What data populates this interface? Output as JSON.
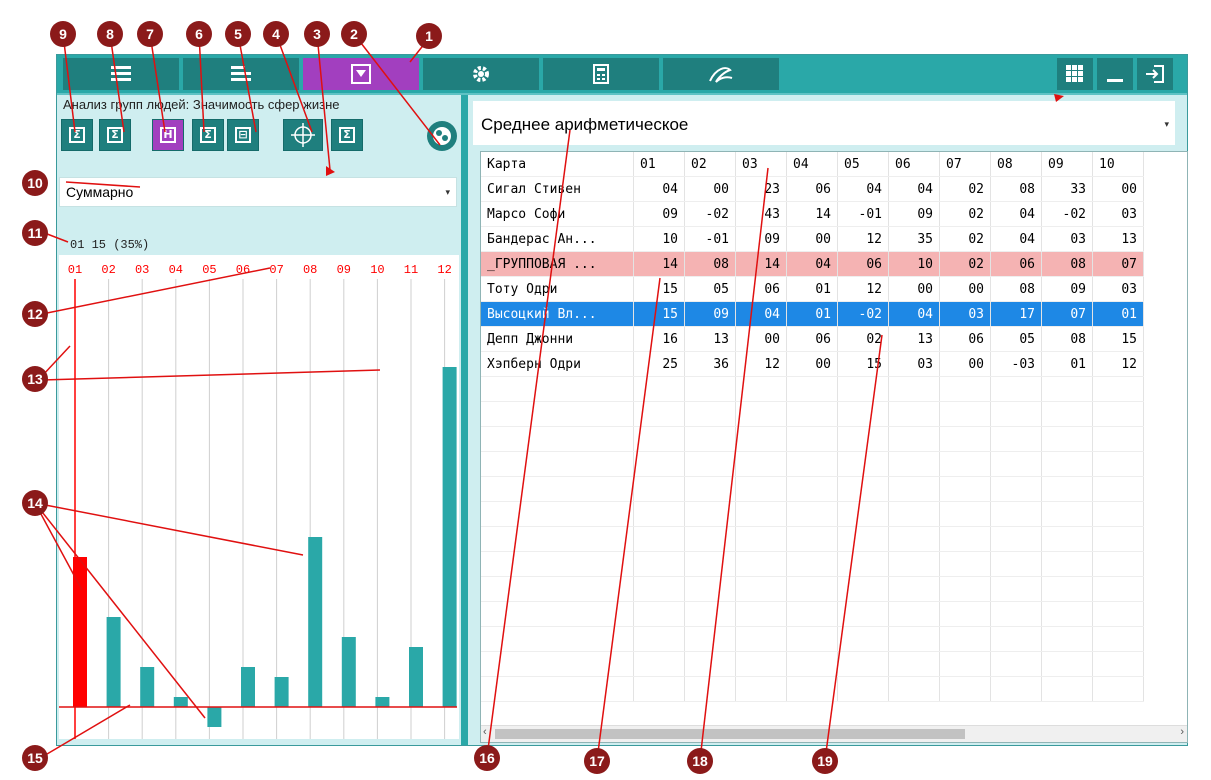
{
  "app": {
    "accent": "#2aa8a8",
    "dark_teal": "#1f7f7e",
    "active_purple": "#a23fbf",
    "tabs": [
      {
        "icon": "list-icon"
      },
      {
        "icon": "list-alt-icon"
      },
      {
        "icon": "filter-icon"
      },
      {
        "icon": "gear-icon"
      },
      {
        "icon": "calculator-icon"
      },
      {
        "icon": "signature-icon"
      }
    ],
    "window_buttons": [
      {
        "icon": "grid-icon"
      },
      {
        "icon": "minimize-icon"
      },
      {
        "icon": "exit-icon"
      }
    ]
  },
  "left": {
    "title": "Анализ групп людей: Значимость сфер жизне",
    "toolbar": [
      {
        "glyph": "Σ",
        "icon": "sum-icon"
      },
      {
        "glyph": "Σ",
        "icon": "sum-weighted-icon"
      },
      {
        "glyph": "H",
        "icon": "histogram-icon"
      },
      {
        "glyph": "Σ",
        "icon": "sum-alt-icon"
      },
      {
        "glyph": "⊟",
        "icon": "collapse-icon"
      },
      {
        "glyph": "⊕",
        "icon": "crosshair-icon"
      },
      {
        "glyph": "Σ",
        "icon": "sum-total-icon"
      }
    ],
    "extra_button_icon": "palette-icon",
    "mode_select": "Суммарно",
    "status": "01 15 (35%)",
    "chart_data": {
      "type": "bar",
      "categories": [
        "01",
        "02",
        "03",
        "04",
        "05",
        "06",
        "07",
        "08",
        "09",
        "10",
        "11",
        "12"
      ],
      "values": [
        15,
        9,
        4,
        1,
        -2,
        4,
        3,
        17,
        7,
        1,
        6,
        34
      ],
      "highlight_index": 0,
      "colors": {
        "bar": "#2aa8a8",
        "highlight": "#ff0000",
        "labels": "#ff0000"
      }
    }
  },
  "right": {
    "aggregate_select": "Среднее арифметическое",
    "table": {
      "columns": [
        "Карта",
        "01",
        "02",
        "03",
        "04",
        "05",
        "06",
        "07",
        "08",
        "09",
        "10"
      ],
      "rows": [
        {
          "name": "Сигал Стивен",
          "values": [
            "04",
            "00",
            "23",
            "06",
            "04",
            "04",
            "02",
            "08",
            "33",
            "00"
          ],
          "state": ""
        },
        {
          "name": "Марсо Софи",
          "values": [
            "09",
            "-02",
            "43",
            "14",
            "-01",
            "09",
            "02",
            "04",
            "-02",
            "03"
          ],
          "state": ""
        },
        {
          "name": "Бандерас Ан...",
          "values": [
            "10",
            "-01",
            "09",
            "00",
            "12",
            "35",
            "02",
            "04",
            "03",
            "13"
          ],
          "state": ""
        },
        {
          "name": "_ГРУППОВАЯ ...",
          "values": [
            "14",
            "08",
            "14",
            "04",
            "06",
            "10",
            "02",
            "06",
            "08",
            "07"
          ],
          "state": "group"
        },
        {
          "name": "Тоту Одри",
          "values": [
            "15",
            "05",
            "06",
            "01",
            "12",
            "00",
            "00",
            "08",
            "09",
            "03"
          ],
          "state": ""
        },
        {
          "name": "Высоцкий Вл...",
          "values": [
            "15",
            "09",
            "04",
            "01",
            "-02",
            "04",
            "03",
            "17",
            "07",
            "01"
          ],
          "state": "selected"
        },
        {
          "name": "Депп Джонни",
          "values": [
            "16",
            "13",
            "00",
            "06",
            "02",
            "13",
            "06",
            "05",
            "08",
            "15"
          ],
          "state": ""
        },
        {
          "name": "Хэпберн Одри",
          "values": [
            "25",
            "36",
            "12",
            "00",
            "15",
            "03",
            "00",
            "-03",
            "01",
            "12"
          ],
          "state": ""
        }
      ],
      "scroll_left": "‹",
      "scroll_right": "›"
    }
  },
  "callouts": [
    "1",
    "2",
    "3",
    "4",
    "5",
    "6",
    "7",
    "8",
    "9",
    "10",
    "11",
    "12",
    "13",
    "14",
    "15",
    "16",
    "17",
    "18",
    "19"
  ]
}
